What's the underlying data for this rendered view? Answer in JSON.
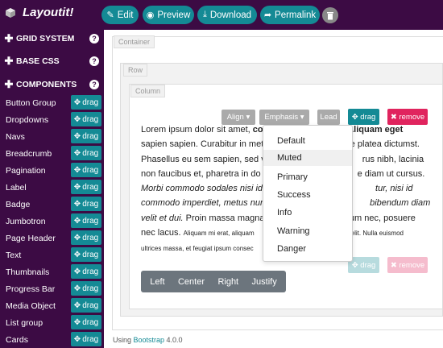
{
  "app": {
    "name": "Layoutit!"
  },
  "toolbar": {
    "edit": "Edit",
    "preview": "Preview",
    "download": "Download",
    "permalink": "Permalink"
  },
  "sidebar": {
    "sections": [
      {
        "label": "GRID SYSTEM"
      },
      {
        "label": "BASE CSS"
      },
      {
        "label": "COMPONENTS"
      }
    ],
    "drag_label": "drag",
    "components": [
      "Button Group",
      "Dropdowns",
      "Navs",
      "Breadcrumb",
      "Pagination",
      "Label",
      "Badge",
      "Jumbotron",
      "Page Header",
      "Text",
      "Thumbnails",
      "Progress Bar",
      "Media Object",
      "List group",
      "Cards"
    ]
  },
  "canvas": {
    "container_tag": "Container",
    "row_tag": "Row",
    "column_tag": "Column"
  },
  "element_controls": {
    "align": "Align",
    "emphasis": "Emphasis",
    "lead": "Lead",
    "drag": "drag",
    "remove": "remove"
  },
  "paragraph": {
    "p1": "Lorem ipsum dolor sit amet, ",
    "p1_bold": "co",
    "p1_tail": "elit. Aliquam eget",
    "l2a": "sapien sapien. Curabitur in met",
    "l2b": "se platea dictumst.",
    "l3a": "Phasellus eu sem sapien, sed v",
    "l3b": "rus nibh, lacinia",
    "l4a": "non faucibus et, pharetra in do",
    "l4b": "e diam ut cursus.",
    "l5a": "Morbi commodo sodales nisi id",
    "l5b": "tur, nisi id",
    "l6a": "commodo imperdiet, metus nun",
    "l6b": "bibendum diam",
    "l7a": "velit et dui.",
    "l7b": " Proin massa magna",
    "l7c": "lum nec, posuere",
    "l8a": "nec lacus. ",
    "l8b": "Aliquam mi erat, aliquam",
    "l8c": "elit. Nulla euismod",
    "l9a": "ultrices massa, et feugiat ipsum consec"
  },
  "emphasis_menu": {
    "items": [
      "Default",
      "Muted",
      "Primary",
      "Success",
      "Info",
      "Warning",
      "Danger"
    ],
    "highlighted": "Muted"
  },
  "align_group": {
    "left": "Left",
    "center": "Center",
    "right": "Right",
    "justify": "Justify"
  },
  "footer": {
    "prefix": "Using ",
    "link": "Bootstrap",
    "version": " 4.0.0"
  },
  "colors": {
    "sidebar_bg": "#3c0b44",
    "teal": "#148a95",
    "remove_red": "#e0245e",
    "gray_btn": "#aaaaaa"
  }
}
